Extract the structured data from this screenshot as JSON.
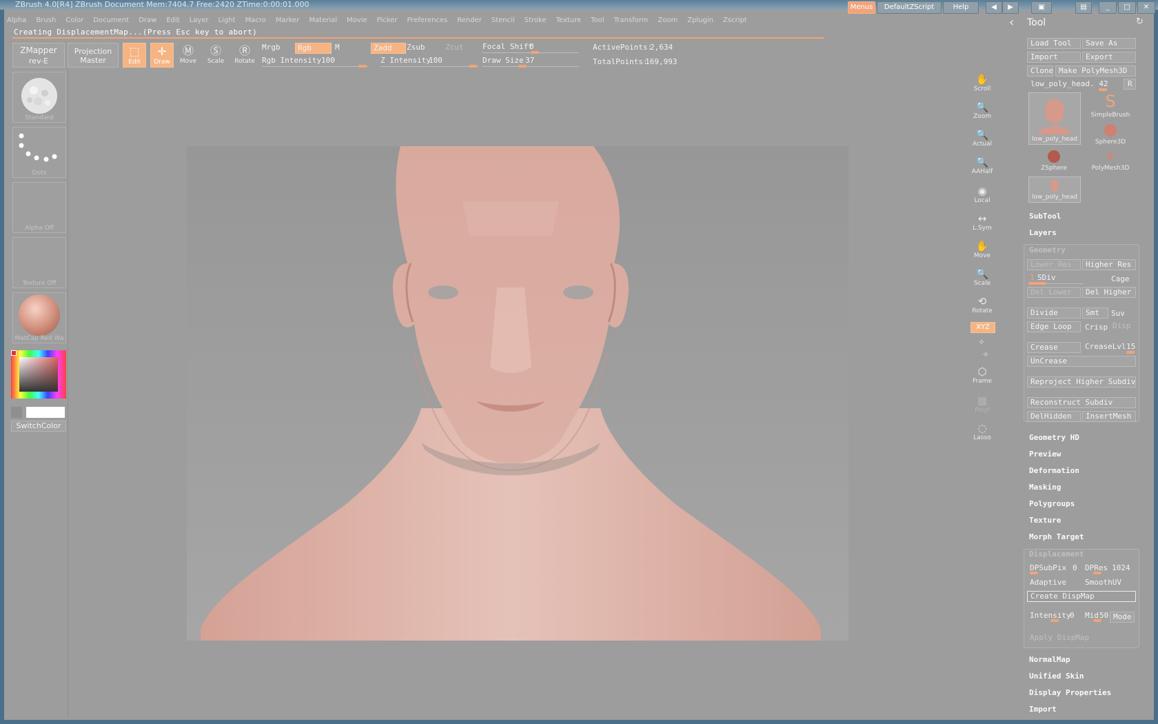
{
  "window": {
    "title": "ZBrush  4.0[R4]   ZBrush Document      Mem:7404.7 Free:2420 ZTime:0:00:01.000",
    "buttons": [
      "Menus",
      "DefaultZScript",
      "Help"
    ]
  },
  "menubar": [
    "Alpha",
    "Brush",
    "Color",
    "Document",
    "Draw",
    "Edit",
    "Layer",
    "Light",
    "Macro",
    "Marker",
    "Material",
    "Movie",
    "Picker",
    "Preferences",
    "Render",
    "Stencil",
    "Stroke",
    "Texture",
    "Tool",
    "Transform",
    "Zoom",
    "Zplugin",
    "Zscript"
  ],
  "status": {
    "message": "Creating DisplacementMap...(Press Esc key to abort)"
  },
  "toolbar": {
    "zmapper": {
      "line1": "ZMapper",
      "line2": "rev-E"
    },
    "projection": {
      "line1": "Projection",
      "line2": "Master"
    },
    "edit": "Edit",
    "draw": "Draw",
    "move": "Move",
    "scale": "Scale",
    "rotate": "Rotate",
    "mrgb": "Mrgb",
    "rgb": "Rgb",
    "m": "M",
    "rgb_intensity": {
      "label": "Rgb Intensity",
      "value": "100"
    },
    "zadd": "Zadd",
    "zsub": "Zsub",
    "zcut": "Zcut",
    "z_intensity": {
      "label": "Z Intensity",
      "value": "100"
    },
    "focal_shift": {
      "label": "Focal Shift",
      "value": "0"
    },
    "draw_size": {
      "label": "Draw Size",
      "value": "37"
    },
    "active_points": {
      "label": "ActivePoints:",
      "value": "2,634"
    },
    "total_points": {
      "label": "TotalPoints:",
      "value": "169,993"
    }
  },
  "leftshelf": {
    "items": [
      {
        "label": "Standard",
        "name": "brush"
      },
      {
        "label": "Dots",
        "name": "stroke"
      },
      {
        "label": "Alpha  Off",
        "name": "alpha"
      },
      {
        "label": "Texture  Off",
        "name": "texture"
      },
      {
        "label": "MatCap  Red  Wa",
        "name": "material"
      }
    ],
    "switch_color": "SwitchColor"
  },
  "rightshelf": [
    {
      "label": "Scroll",
      "glyph": "✋"
    },
    {
      "label": "Zoom",
      "glyph": "🔍"
    },
    {
      "label": "Actual",
      "glyph": "🔍"
    },
    {
      "label": "AAHalf",
      "glyph": "🔍"
    },
    {
      "label": "Local",
      "glyph": "◉"
    },
    {
      "label": "L.Sym",
      "glyph": "↔"
    },
    {
      "label": "Move",
      "glyph": "✋"
    },
    {
      "label": "Scale",
      "glyph": "🔍"
    },
    {
      "label": "Rotate",
      "glyph": "⟲"
    },
    {
      "label": "Frame",
      "glyph": "⬡"
    },
    {
      "label": "Polyf",
      "glyph": "▦"
    },
    {
      "label": "Lasso",
      "glyph": "◌"
    }
  ],
  "xyz": "XYZ",
  "tool": {
    "title": "Tool",
    "load_tool": "Load Tool",
    "save_as": "Save As",
    "import": "Import",
    "export": "Export",
    "clone": "Clone",
    "make_polymesh": "Make PolyMesh3D",
    "current_tool": "low_poly_head. 42",
    "r": "R",
    "thumbs": [
      "low_poly_head",
      "SimpleBrush",
      "Sphere3D",
      "ZSphere",
      "PolyMesh3D",
      "low_poly_head"
    ],
    "subtool": "SubTool",
    "layers": "Layers",
    "geometry": {
      "title": "Geometry",
      "lower_res": "Lower Res",
      "higher_res": "Higher Res",
      "sdiv_value": "1",
      "sdiv_label": "SDiv",
      "cage": "Cage",
      "del_lower": "Del Lower",
      "del_higher": "Del Higher",
      "divide": "Divide",
      "smt": "Smt",
      "suv": "Suv",
      "edge_loop": "Edge Loop",
      "crisp": "Crisp",
      "disp": "Disp",
      "crease": "Crease",
      "crease_lvl": {
        "label": "CreaseLvl",
        "value": "15"
      },
      "uncrease": "UnCrease",
      "reproject": "Reproject Higher Subdiv",
      "reconstruct": "Reconstruct Subdiv",
      "delhidden": "DelHidden",
      "insertmesh": "InsertMesh"
    },
    "sections_a": [
      "Geometry HD",
      "Preview",
      "Deformation",
      "Masking",
      "Polygroups",
      "Texture",
      "Morph Target"
    ],
    "displacement": {
      "title": "Displacement",
      "dpsubpix": {
        "label": "DPSubPix",
        "value": "0"
      },
      "dpres": {
        "label": "DPRes",
        "value": "1024"
      },
      "adaptive": "Adaptive",
      "smoothuv": "SmoothUV",
      "create": "Create DispMap",
      "intensity": {
        "label": "Intensity",
        "value": "0"
      },
      "mid": {
        "label": "Mid",
        "value": "50"
      },
      "mode": "Mode",
      "apply": "Apply DispMap"
    },
    "sections_b": [
      "NormalMap",
      "Unified Skin",
      "Display Properties",
      "Import"
    ]
  },
  "colors": {
    "accent": "#f6b483",
    "skin": "#e6aa98",
    "bg": "#9d9d9d"
  }
}
